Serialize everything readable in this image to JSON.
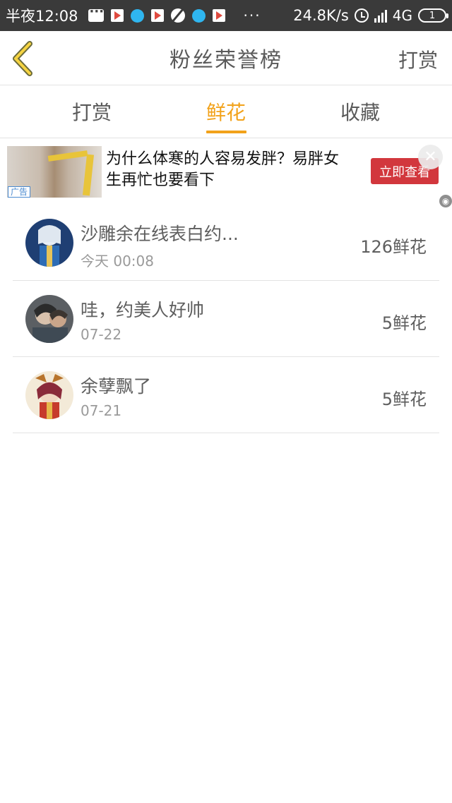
{
  "status_bar": {
    "time": "半夜12:08",
    "dots": "···",
    "speed": "24.8K/s",
    "network": "4G",
    "battery": "1"
  },
  "header": {
    "title": "粉丝荣誉榜",
    "action_label": "打赏",
    "accent_color": "#f2a21a"
  },
  "tabs": [
    {
      "label": "打赏",
      "active": false
    },
    {
      "label": "鲜花",
      "active": true
    },
    {
      "label": "收藏",
      "active": false
    }
  ],
  "ad": {
    "badge": "广告",
    "text": "为什么体寒的人容易发胖？易胖女生再忙也要看下",
    "cta": "立即查看",
    "cta_color": "#d2373d"
  },
  "fans": [
    {
      "name": "沙雕余在线表白约...",
      "date": "今天 00:08",
      "amount": "126鲜花"
    },
    {
      "name": "哇，约美人好帅",
      "date": "07-22",
      "amount": "5鲜花"
    },
    {
      "name": "余孽飘了",
      "date": "07-21",
      "amount": "5鲜花"
    }
  ]
}
